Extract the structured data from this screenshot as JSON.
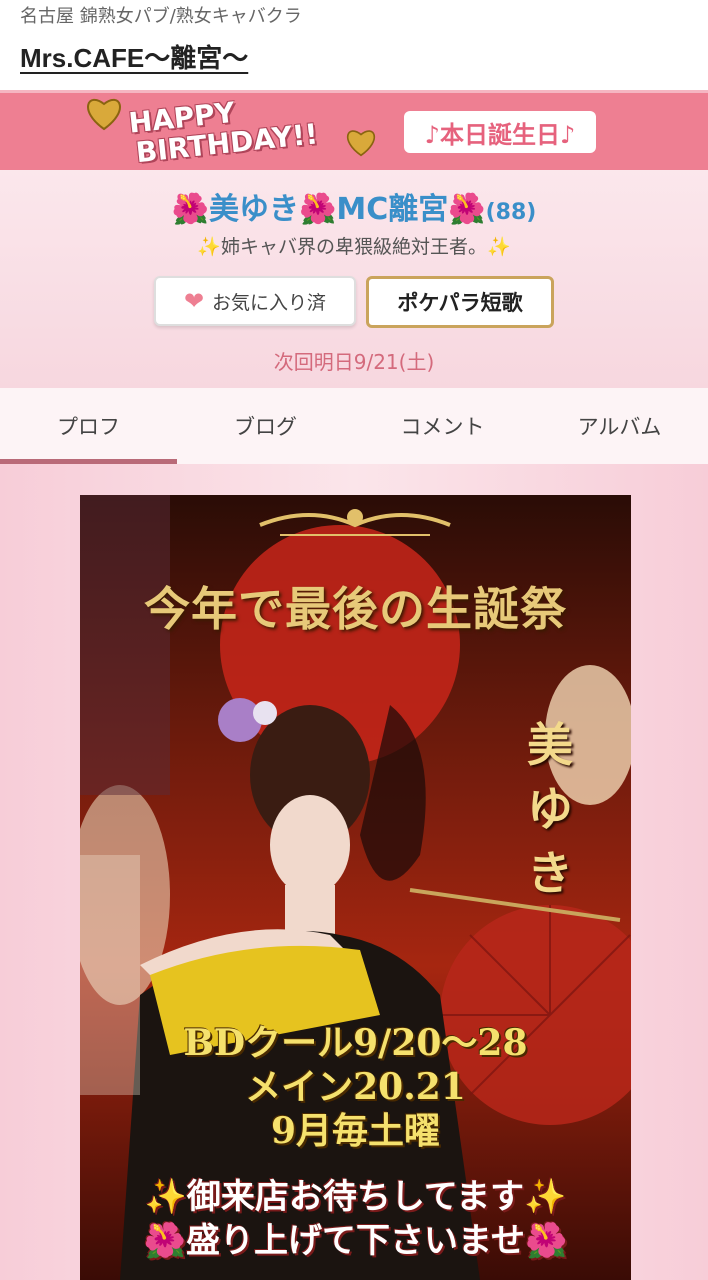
{
  "header": {
    "area": "名古屋 錦熟女パブ/熟女キャバクラ",
    "shop_name": "Mrs.CAFE〜離宮〜"
  },
  "birthday_bar": {
    "line1": "HAPPY",
    "line2": "BIRTHDAY!!",
    "badge": "♪本日誕生日♪"
  },
  "profile": {
    "flower": "🌺",
    "name1": "美ゆき",
    "name2": "MC離宮",
    "count": "(88)",
    "sparkle": "✨",
    "catch": "姉キャバ界の卑猥級絶対王者。",
    "favorite_label": "お気に入り済",
    "tanka_label": "ポケパラ短歌",
    "next": "次回明日9/21(土)"
  },
  "tabs": [
    {
      "label": "プロフ",
      "active": true
    },
    {
      "label": "ブログ",
      "active": false
    },
    {
      "label": "コメント",
      "active": false
    },
    {
      "label": "アルバム",
      "active": false
    }
  ],
  "poster": {
    "title": "今年で最後の生誕祭",
    "name": "美ゆき",
    "line1": "BDクール9/20〜28",
    "line2": "メイン20.21",
    "line3": "9月毎土曜",
    "msg1": "✨御来店お待ちしてます✨",
    "msg2": "🌺盛り上げて下さいませ🌺"
  },
  "colors": {
    "brand_pink": "#ee7f92",
    "name_blue": "#3a8fc9",
    "accent_gold": "#caa45c"
  }
}
